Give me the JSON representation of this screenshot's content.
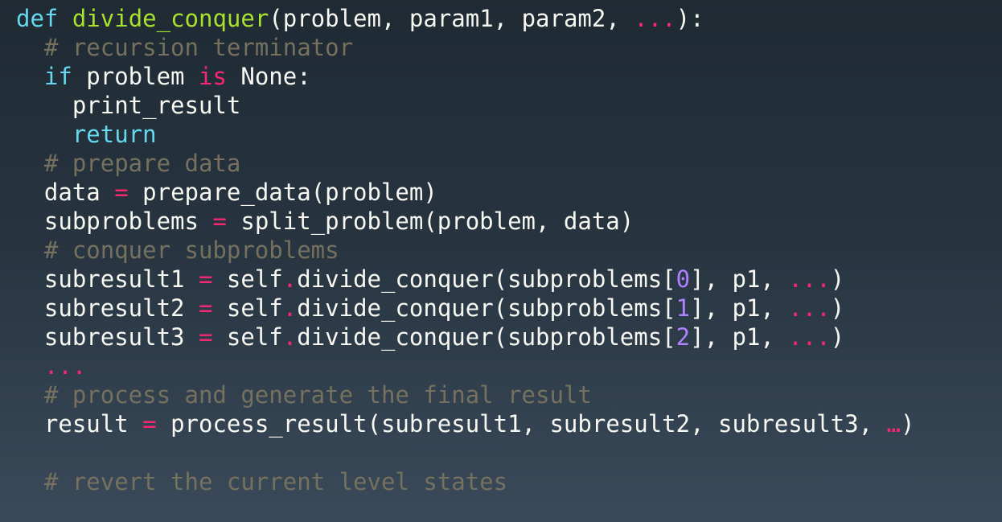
{
  "code": {
    "lines": [
      [
        {
          "t": "def",
          "c": "kw"
        },
        {
          "t": " ",
          "c": "tx"
        },
        {
          "t": "divide_conquer",
          "c": "fn"
        },
        {
          "t": "(problem, param1, param2, ",
          "c": "tx"
        },
        {
          "t": "...",
          "c": "op"
        },
        {
          "t": "):",
          "c": "tx"
        }
      ],
      [
        {
          "t": "  # recursion terminator",
          "c": "cm"
        }
      ],
      [
        {
          "t": "  ",
          "c": "tx"
        },
        {
          "t": "if",
          "c": "kw"
        },
        {
          "t": " problem ",
          "c": "tx"
        },
        {
          "t": "is",
          "c": "op"
        },
        {
          "t": " None:",
          "c": "tx"
        }
      ],
      [
        {
          "t": "    print_result",
          "c": "tx"
        }
      ],
      [
        {
          "t": "    ",
          "c": "tx"
        },
        {
          "t": "return",
          "c": "kw"
        }
      ],
      [
        {
          "t": "  # prepare data",
          "c": "cm"
        }
      ],
      [
        {
          "t": "  data ",
          "c": "tx"
        },
        {
          "t": "=",
          "c": "op"
        },
        {
          "t": " prepare_data(problem)",
          "c": "tx"
        }
      ],
      [
        {
          "t": "  subproblems ",
          "c": "tx"
        },
        {
          "t": "=",
          "c": "op"
        },
        {
          "t": " split_problem(problem, data)",
          "c": "tx"
        }
      ],
      [
        {
          "t": "  # conquer subproblems",
          "c": "cm"
        }
      ],
      [
        {
          "t": "  subresult1 ",
          "c": "tx"
        },
        {
          "t": "=",
          "c": "op"
        },
        {
          "t": " self",
          "c": "tx"
        },
        {
          "t": ".",
          "c": "op"
        },
        {
          "t": "divide_conquer(subproblems[",
          "c": "tx"
        },
        {
          "t": "0",
          "c": "num"
        },
        {
          "t": "], p1, ",
          "c": "tx"
        },
        {
          "t": "...",
          "c": "op"
        },
        {
          "t": ")",
          "c": "tx"
        }
      ],
      [
        {
          "t": "  subresult2 ",
          "c": "tx"
        },
        {
          "t": "=",
          "c": "op"
        },
        {
          "t": " self",
          "c": "tx"
        },
        {
          "t": ".",
          "c": "op"
        },
        {
          "t": "divide_conquer(subproblems[",
          "c": "tx"
        },
        {
          "t": "1",
          "c": "num"
        },
        {
          "t": "], p1, ",
          "c": "tx"
        },
        {
          "t": "...",
          "c": "op"
        },
        {
          "t": ")",
          "c": "tx"
        }
      ],
      [
        {
          "t": "  subresult3 ",
          "c": "tx"
        },
        {
          "t": "=",
          "c": "op"
        },
        {
          "t": " self",
          "c": "tx"
        },
        {
          "t": ".",
          "c": "op"
        },
        {
          "t": "divide_conquer(subproblems[",
          "c": "tx"
        },
        {
          "t": "2",
          "c": "num"
        },
        {
          "t": "], p1, ",
          "c": "tx"
        },
        {
          "t": "...",
          "c": "op"
        },
        {
          "t": ")",
          "c": "tx"
        }
      ],
      [
        {
          "t": "  ",
          "c": "tx"
        },
        {
          "t": "...",
          "c": "op"
        }
      ],
      [
        {
          "t": "  # process and generate the final result",
          "c": "cm"
        }
      ],
      [
        {
          "t": "  result ",
          "c": "tx"
        },
        {
          "t": "=",
          "c": "op"
        },
        {
          "t": " process_result(subresult1, subresult2, subresult3, ",
          "c": "tx"
        },
        {
          "t": "…",
          "c": "op"
        },
        {
          "t": ")",
          "c": "tx"
        }
      ],
      [],
      [
        {
          "t": "  # revert the current level states",
          "c": "cm"
        }
      ]
    ]
  },
  "colors": {
    "background_top": "#1f2a33",
    "background_bottom": "#3a4a5a",
    "keyword": "#66d9ef",
    "function_name": "#a6e22e",
    "operator": "#f92672",
    "number": "#ae81ff",
    "comment": "#75715e",
    "text": "#f8f8f2"
  }
}
